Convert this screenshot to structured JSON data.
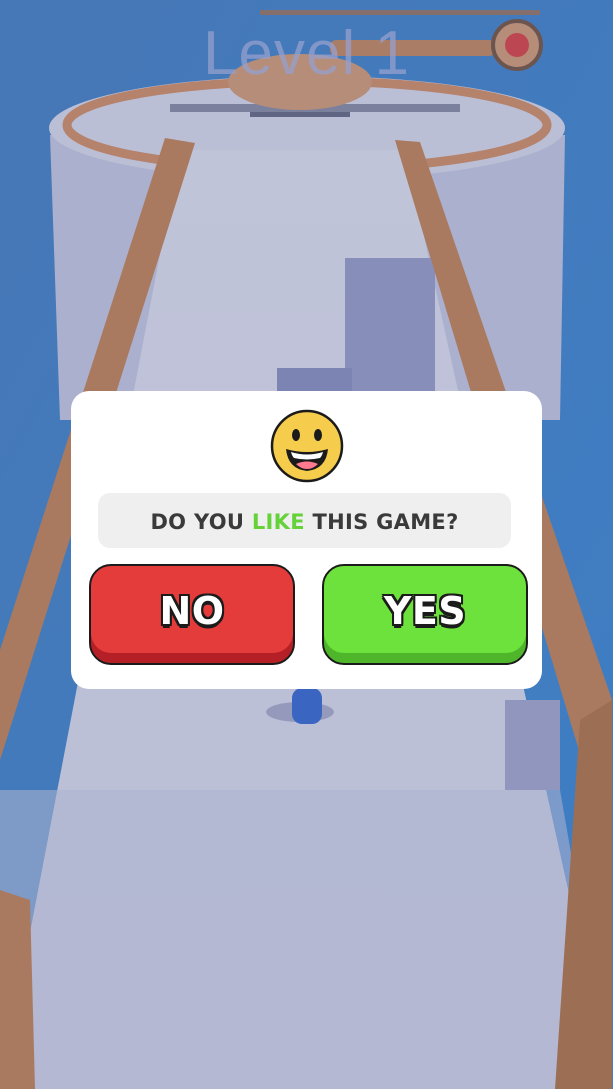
{
  "hud": {
    "level_text": "Level 1"
  },
  "dialog": {
    "question_before": "DO YOU",
    "question_highlight": "LIKE",
    "question_after": "THIS GAME?",
    "no_label": "NO",
    "yes_label": "YES",
    "emoji_icon": "grinning-face-icon"
  },
  "colors": {
    "no_button": "#e43b3b",
    "yes_button": "#6ee23c",
    "highlight_text": "#66d23a",
    "sky": "#5aa0e0",
    "rail": "#c88a5a"
  }
}
